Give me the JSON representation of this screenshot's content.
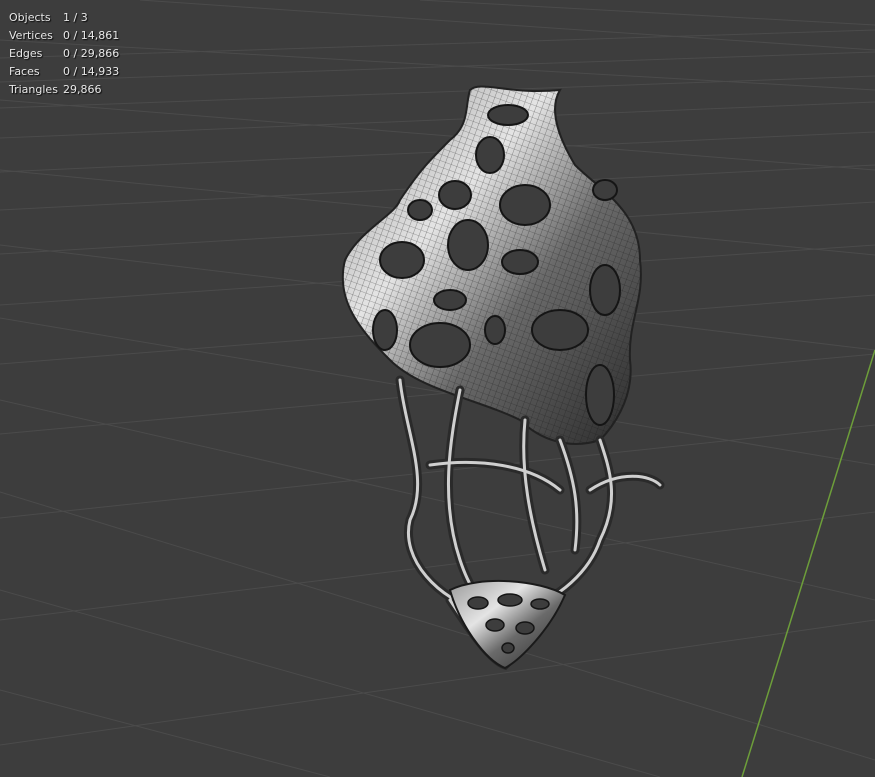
{
  "stats": {
    "objects": {
      "label": "Objects",
      "value": "1 / 3"
    },
    "vertices": {
      "label": "Vertices",
      "value": "0 / 14,861"
    },
    "edges": {
      "label": "Edges",
      "value": "0 / 29,866"
    },
    "faces": {
      "label": "Faces",
      "value": "0 / 14,933"
    },
    "triangles": {
      "label": "Triangles",
      "value": "29,866"
    }
  },
  "colors": {
    "background": "#3d3d3d",
    "grid": "#4a4a4a",
    "y_axis": "#6d9e3a",
    "mesh_light": "#d8d8d8",
    "mesh_dark": "#1c1c1c"
  }
}
